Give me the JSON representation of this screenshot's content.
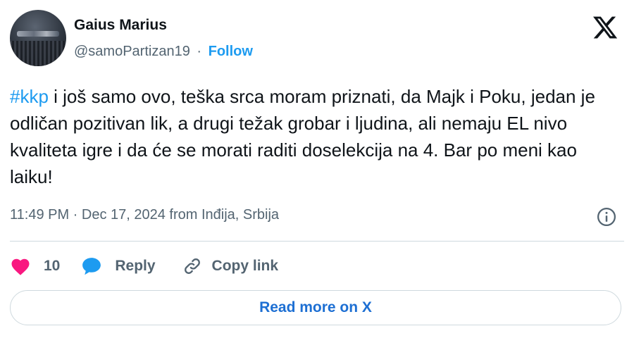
{
  "author": {
    "name": "Gaius Marius",
    "handle": "@samoPartizan19",
    "separator": "·",
    "follow_label": "Follow"
  },
  "logo_icon": "x-logo-icon",
  "tweet": {
    "hashtag": "#kkp",
    "body": " i još samo ovo, teška srca moram priznati, da Majk i Poku, jedan je odličan pozitivan lik, a drugi težak grobar i ljudina, ali nemaju EL nivo kvaliteta igre i da će se morati raditi doselekcija na 4. Bar po meni kao laiku!",
    "meta": "11:49 PM · Dec 17, 2024 from Inđija, Srbija"
  },
  "actions": {
    "likes_count": "10",
    "reply_label": "Reply",
    "copy_link_label": "Copy link"
  },
  "read_more_label": "Read more on X",
  "colors": {
    "accent": "#1d9bf0",
    "like": "#f91880",
    "text": "#0f1419",
    "muted": "#536471"
  }
}
